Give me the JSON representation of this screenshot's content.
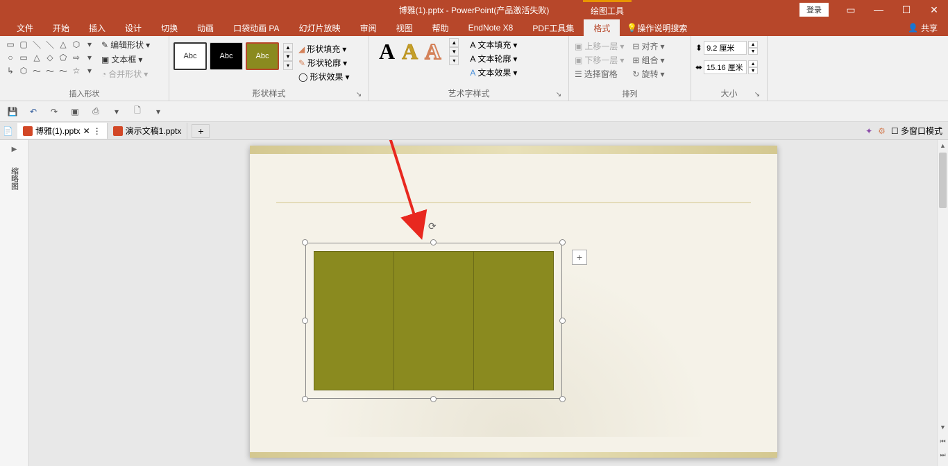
{
  "titlebar": {
    "document_title": "博雅(1).pptx  -  PowerPoint(产品激活失败)",
    "contextual_label": "绘图工具",
    "login": "登录"
  },
  "tabs": {
    "items": [
      "文件",
      "开始",
      "插入",
      "设计",
      "切换",
      "动画",
      "口袋动画 PA",
      "幻灯片放映",
      "审阅",
      "视图",
      "帮助",
      "EndNote X8",
      "PDF工具集",
      "格式"
    ],
    "active_index": 13,
    "tell_me": "操作说明搜索",
    "share": "共享"
  },
  "ribbon": {
    "groups": {
      "shapes": {
        "label": "插入形状",
        "edit_shape": "编辑形状",
        "text_box": "文本框",
        "merge": "合并形状"
      },
      "styles": {
        "label": "形状样式",
        "abc": "Abc",
        "fill": "形状填充",
        "outline": "形状轮廓",
        "effects": "形状效果"
      },
      "wordart": {
        "label": "艺术字样式",
        "text_fill": "文本填充",
        "text_outline": "文本轮廓",
        "text_effects": "文本效果",
        "sample": "A"
      },
      "arrange": {
        "label": "排列",
        "forward": "上移一层",
        "backward": "下移一层",
        "selection_pane": "选择窗格",
        "align": "对齐",
        "group": "组合",
        "rotate": "旋转"
      },
      "size": {
        "label": "大小",
        "height": "9.2 厘米",
        "width": "15.16 厘米"
      }
    }
  },
  "doc_tabs": {
    "items": [
      {
        "name": "博雅(1).pptx",
        "active": true
      },
      {
        "name": "演示文稿1.pptx",
        "active": false
      }
    ],
    "multi_window": "多窗口模式"
  },
  "side_panel": {
    "label": "缩略图"
  }
}
